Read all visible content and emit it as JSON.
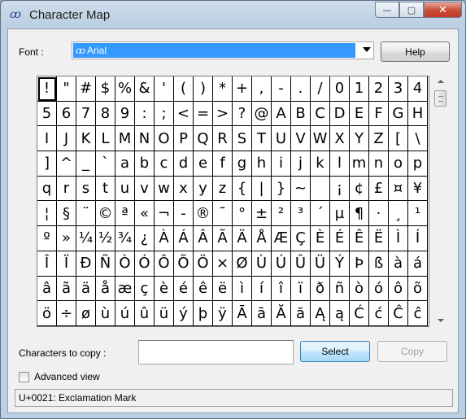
{
  "window": {
    "title": "Character Map",
    "icon": "charmap-app-icon",
    "buttons": {
      "minimize": "—",
      "maximize": "▢",
      "close": "✕"
    }
  },
  "font": {
    "label": "Font :",
    "selected": "Arial",
    "help_label": "Help"
  },
  "grid": {
    "selected_index": 0,
    "chars": [
      "!",
      "\"",
      "#",
      "$",
      "%",
      "&",
      "'",
      "(",
      ")",
      "*",
      "+",
      ",",
      "-",
      ".",
      "/",
      "0",
      "1",
      "2",
      "3",
      "4",
      "5",
      "6",
      "7",
      "8",
      "9",
      ":",
      ";",
      "<",
      "=",
      ">",
      "?",
      "@",
      "A",
      "B",
      "C",
      "D",
      "E",
      "F",
      "G",
      "H",
      "I",
      "J",
      "K",
      "L",
      "M",
      "N",
      "O",
      "P",
      "Q",
      "R",
      "S",
      "T",
      "U",
      "V",
      "W",
      "X",
      "Y",
      "Z",
      "[",
      "\\",
      "]",
      "^",
      "_",
      "`",
      "a",
      "b",
      "c",
      "d",
      "e",
      "f",
      "g",
      "h",
      "i",
      "j",
      "k",
      "l",
      "m",
      "n",
      "o",
      "p",
      "q",
      "r",
      "s",
      "t",
      "u",
      "v",
      "w",
      "x",
      "y",
      "z",
      "{",
      "|",
      "}",
      "~",
      " ",
      "¡",
      "¢",
      "£",
      "¤",
      "¥",
      "¦",
      "§",
      "¨",
      "©",
      "ª",
      "«",
      "¬",
      "-",
      "®",
      "¯",
      "°",
      "±",
      "²",
      "³",
      "´",
      "µ",
      "¶",
      "·",
      "¸",
      "¹",
      "º",
      "»",
      "¼",
      "½",
      "¾",
      "¿",
      "À",
      "Á",
      "Â",
      "Ã",
      "Ä",
      "Å",
      "Æ",
      "Ç",
      "È",
      "É",
      "Ê",
      "Ë",
      "Ì",
      "Í",
      "Î",
      "Ï",
      "Ð",
      "Ñ",
      "Ò",
      "Ó",
      "Ô",
      "Õ",
      "Ö",
      "×",
      "Ø",
      "Ù",
      "Ú",
      "Û",
      "Ü",
      "Ý",
      "Þ",
      "ß",
      "à",
      "á",
      "â",
      "ã",
      "ä",
      "å",
      "æ",
      "ç",
      "è",
      "é",
      "ê",
      "ë",
      "ì",
      "í",
      "î",
      "ï",
      "ð",
      "ñ",
      "ò",
      "ó",
      "ô",
      "õ",
      "ö",
      "÷",
      "ø",
      "ù",
      "ú",
      "û",
      "ü",
      "ý",
      "þ",
      "ÿ",
      "Ā",
      "ā",
      "Ă",
      "ă",
      "Ą",
      "ą",
      "Ć",
      "ć",
      "Ĉ",
      "ĉ"
    ]
  },
  "copy": {
    "label": "Characters to copy :",
    "value": "",
    "select_label": "Select",
    "copy_label": "Copy"
  },
  "advanced": {
    "label": "Advanced view",
    "checked": false
  },
  "status": {
    "text": "U+0021: Exclamation Mark"
  }
}
